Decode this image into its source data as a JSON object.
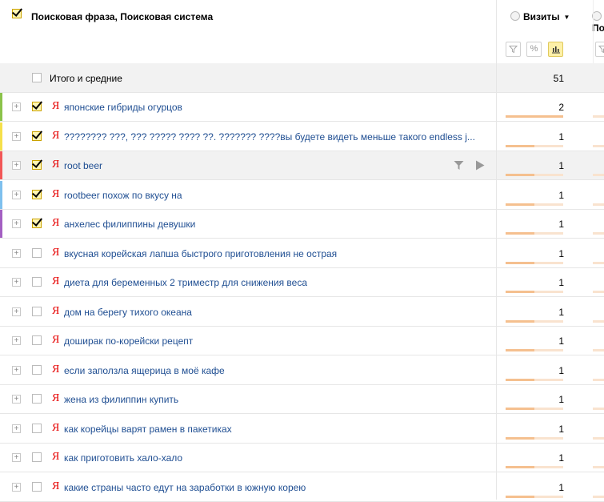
{
  "header": {
    "dimension_title": "Поисковая фраза, Поисковая система",
    "dimension_checked": true,
    "metric_label": "Визиты",
    "metric_sort_arrow": "▼",
    "metric2_label": "По",
    "view_buttons": [
      {
        "name": "filter",
        "icon": "funnel-icon",
        "active": false
      },
      {
        "name": "percent",
        "label": "%",
        "active": false
      },
      {
        "name": "bars",
        "icon": "bar-chart-icon",
        "active": true
      }
    ]
  },
  "totals": {
    "label": "Итого и средние",
    "visits": "51"
  },
  "rows": [
    {
      "text": "японские гибриды огурцов",
      "visits": "2",
      "checked": true,
      "stripe": "#8bc34a",
      "bar_fraction": 1.0
    },
    {
      "text": "???????? ???, ??? ????? ???? ??. ??????? ????вы будете видеть меньше такого endless j...",
      "visits": "1",
      "checked": true,
      "stripe": "#f5e04b",
      "bar_fraction": 0.5
    },
    {
      "text": "root beer",
      "visits": "1",
      "checked": true,
      "stripe": "#f25757",
      "bar_fraction": 0.5,
      "highlight": true
    },
    {
      "text": "rootbeer похож по вкусу на",
      "visits": "1",
      "checked": true,
      "stripe": "#7ec0ee",
      "bar_fraction": 0.5
    },
    {
      "text": "анхелес филиппины девушки",
      "visits": "1",
      "checked": true,
      "stripe": "#a35fc2",
      "bar_fraction": 0.5
    },
    {
      "text": "вкусная корейская лапша быстрого приготовления не острая",
      "visits": "1",
      "checked": false,
      "stripe": "",
      "bar_fraction": 0.5
    },
    {
      "text": "диета для беременных 2 триместр для снижения веса",
      "visits": "1",
      "checked": false,
      "stripe": "",
      "bar_fraction": 0.5
    },
    {
      "text": "дом на берегу тихого океана",
      "visits": "1",
      "checked": false,
      "stripe": "",
      "bar_fraction": 0.5
    },
    {
      "text": "доширак по-корейски рецепт",
      "visits": "1",
      "checked": false,
      "stripe": "",
      "bar_fraction": 0.5
    },
    {
      "text": "если заползла ящерица в моё кафе",
      "visits": "1",
      "checked": false,
      "stripe": "",
      "bar_fraction": 0.5
    },
    {
      "text": "жена из филиппин купить",
      "visits": "1",
      "checked": false,
      "stripe": "",
      "bar_fraction": 0.5
    },
    {
      "text": "как корейцы варят рамен в пакетиках",
      "visits": "1",
      "checked": false,
      "stripe": "",
      "bar_fraction": 0.5
    },
    {
      "text": "как приготовить хало-хало",
      "visits": "1",
      "checked": false,
      "stripe": "",
      "bar_fraction": 0.5
    },
    {
      "text": "какие страны часто едут на заработки в южную корею",
      "visits": "1",
      "checked": false,
      "stripe": "",
      "bar_fraction": 0.5
    }
  ],
  "search_engine_glyph": "Я",
  "expand_glyph": "+",
  "colors": {
    "link": "#1f4e92",
    "yandex_red": "#e60000",
    "bar_fill": "#f5c08f",
    "bar_track": "#f9e3cf"
  }
}
